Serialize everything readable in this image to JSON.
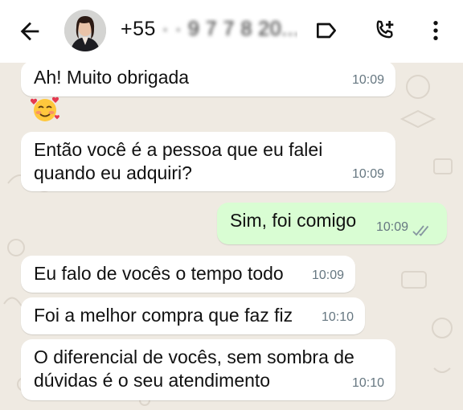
{
  "header": {
    "contact_name_visible": "+55",
    "contact_name_blurred": " · · 9 7 7 8 20...",
    "back_icon": "arrow-left-icon",
    "label_icon": "label-icon",
    "call_icon": "add-call-icon",
    "menu_icon": "more-vert-icon"
  },
  "messages": [
    {
      "text": "Ah! Muito obrigada",
      "time": "10:09",
      "direction": "in"
    },
    {
      "text": "🥰",
      "time": "",
      "direction": "in",
      "kind": "emoji"
    },
    {
      "text": "Então você é a pessoa que eu falei quando eu adquiri?",
      "time": "10:09",
      "direction": "in"
    },
    {
      "text": "Sim, foi comigo",
      "time": "10:09",
      "direction": "out",
      "status": "read"
    },
    {
      "text": "Eu falo de vocês o tempo todo",
      "time": "10:09",
      "direction": "in"
    },
    {
      "text": "Foi a melhor compra que faz fiz",
      "time": "10:10",
      "direction": "in"
    },
    {
      "text": "O diferencial de vocês, sem sombra de dúvidas é o seu atendimento",
      "time": "10:10",
      "direction": "in"
    }
  ],
  "colors": {
    "header_bg": "#ffffff",
    "chat_bg": "#efeae2",
    "incoming_bubble": "#ffffff",
    "outgoing_bubble": "#d9fdd3",
    "timestamp": "#667781",
    "read_ticks": "#8696a0"
  }
}
